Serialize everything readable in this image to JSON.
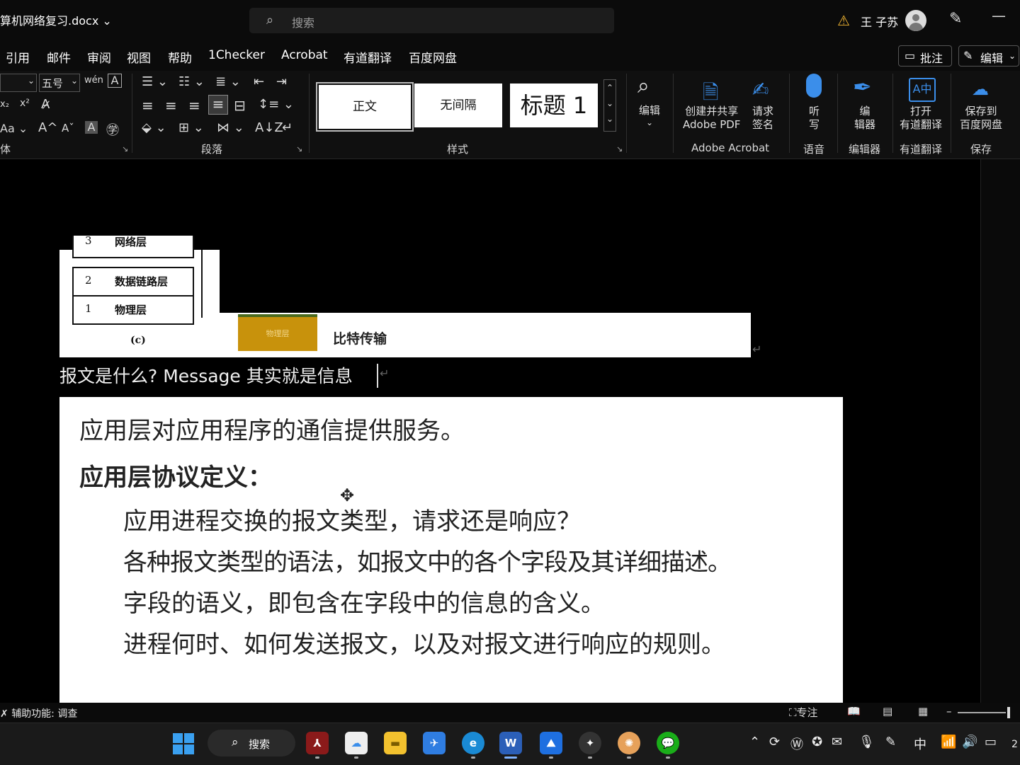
{
  "titlebar": {
    "doc_title": "算机网络复习.docx",
    "title_chevron": "⌄",
    "search_placeholder": "搜索",
    "user_name": "王 子苏",
    "minimize": "—"
  },
  "menu": {
    "tabs": [
      "引用",
      "邮件",
      "审阅",
      "视图",
      "帮助",
      "1Checker",
      "Acrobat",
      "有道翻译",
      "百度网盘"
    ],
    "comment_button": "批注",
    "edit_mode_button": "编辑"
  },
  "ribbon": {
    "font_size": "五号",
    "font_group_label": "体",
    "paragraph_group_label": "段落",
    "styles_group_label": "样式",
    "styles": [
      "正文",
      "无间隔",
      "标题 1"
    ],
    "editing_label": "编辑",
    "acrobat_create_label": "创建并共享\nAdobe PDF",
    "acrobat_sign_label": "请求\n签名",
    "acrobat_group_label": "Adobe Acrobat",
    "dictate_label": "听\n写",
    "voice_group_label": "语音",
    "editor_label": "编\n辑器",
    "editor_group_label": "编辑器",
    "youdao_label": "打开\n有道翻译",
    "youdao_group_label": "有道翻译",
    "baidu_label": "保存到\n百度网盘",
    "save_group_label": "保存"
  },
  "document": {
    "osi_top_partial": {
      "num": "3",
      "text": "网络层"
    },
    "osi_rows": [
      {
        "num": "2",
        "text": "数据链路层"
      },
      {
        "num": "1",
        "text": "物理层"
      }
    ],
    "fig_caption": "(c)",
    "phys_tag": "物理层",
    "bit_transfer": "比特传输",
    "body_line": "报文是什么? Message  其实就是信息",
    "paragraph_mark": "↵",
    "fig3": {
      "line1": "应用层对应用程序的通信提供服务。",
      "heading": "应用层协议定义：",
      "items": [
        "应用进程交换的报文类型，请求还是响应？",
        "各种报文类型的语法，如报文中的各个字段及其详细描述。",
        "字段的语义，即包含在字段中的信息的含义。",
        "进程何时、如何发送报文，以及对报文进行响应的规则。"
      ]
    }
  },
  "statusbar": {
    "accessibility": "辅助功能: 调查",
    "focus": "专注",
    "zoom_minus": "–"
  },
  "taskbar": {
    "search_label": "搜索",
    "ime": "中",
    "clock_partial": "2"
  },
  "colors": {
    "accent_blue": "#3b8eea",
    "warning": "#f2b632",
    "phys_tag": "#c8920c"
  }
}
